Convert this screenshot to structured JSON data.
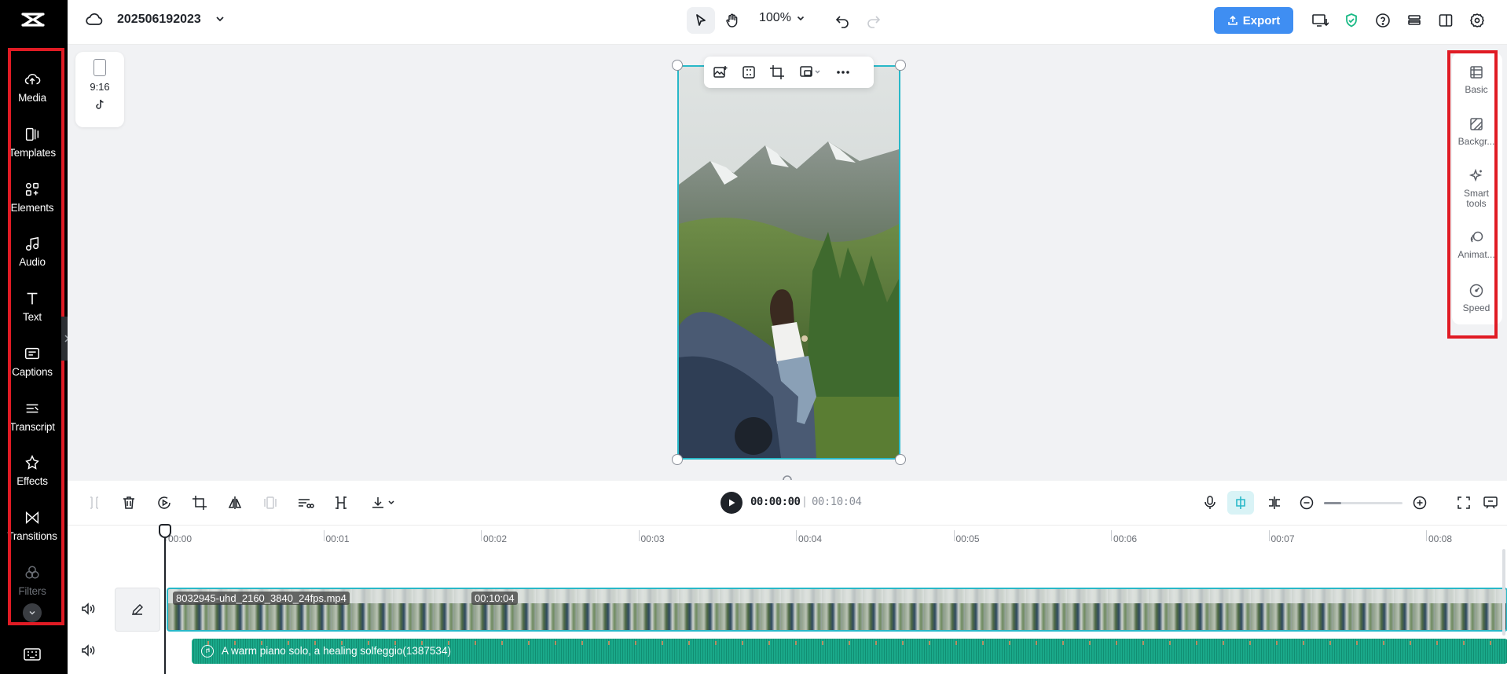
{
  "project": {
    "name": "202506192023"
  },
  "toolbar": {
    "zoom": "100%",
    "export_label": "Export"
  },
  "canvas": {
    "aspect_ratio": "9:16"
  },
  "sidebar": {
    "items": [
      {
        "label": "Media",
        "icon": "upload-cloud-icon"
      },
      {
        "label": "Templates",
        "icon": "templates-icon"
      },
      {
        "label": "Elements",
        "icon": "elements-icon"
      },
      {
        "label": "Audio",
        "icon": "music-note-icon"
      },
      {
        "label": "Text",
        "icon": "text-icon"
      },
      {
        "label": "Captions",
        "icon": "captions-icon"
      },
      {
        "label": "Transcript",
        "icon": "transcript-icon"
      },
      {
        "label": "Effects",
        "icon": "effects-icon"
      },
      {
        "label": "Transitions",
        "icon": "transitions-icon"
      },
      {
        "label": "Filters",
        "icon": "filters-icon"
      }
    ]
  },
  "right_panel": {
    "items": [
      {
        "label": "Basic",
        "icon": "basic-icon"
      },
      {
        "label": "Backgr...",
        "icon": "background-icon"
      },
      {
        "label": "Smart tools",
        "icon": "sparkle-icon"
      },
      {
        "label": "Animat...",
        "icon": "animation-icon"
      },
      {
        "label": "Speed",
        "icon": "speed-icon"
      }
    ]
  },
  "playback": {
    "current": "00:00:00",
    "separator": "|",
    "total": "00:10:04"
  },
  "ruler": [
    "00:00",
    "00:01",
    "00:02",
    "00:03",
    "00:04",
    "00:05",
    "00:06",
    "00:07",
    "00:08"
  ],
  "tracks": {
    "video": {
      "name": "8032945-uhd_2160_3840_24fps.mp4",
      "duration": "00:10:04"
    },
    "audio": {
      "name": "A warm piano solo, a healing solfeggio(1387534)"
    }
  },
  "colors": {
    "accent": "#28b8c8",
    "export": "#3f8ef2",
    "audio_track": "#1aa98a",
    "highlight": "#e01b24"
  }
}
